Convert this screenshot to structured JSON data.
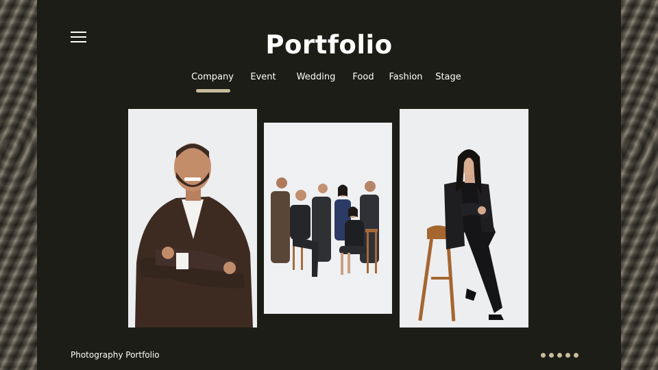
{
  "page": {
    "title": "Portfolio",
    "footer_label": "Photography Portfolio"
  },
  "nav": {
    "menu_icon": "hamburger-menu-icon",
    "tabs": [
      {
        "label": "Company",
        "active": true
      },
      {
        "label": "Event",
        "active": false
      },
      {
        "label": "Wedding",
        "active": false
      },
      {
        "label": "Food",
        "active": false
      },
      {
        "label": "Fashion",
        "active": false
      },
      {
        "label": "Stage",
        "active": false
      }
    ]
  },
  "gallery": {
    "photos": [
      {
        "subject": "smiling man in brown suit with arms crossed"
      },
      {
        "subject": "group of six business people in dark suits"
      },
      {
        "subject": "woman in black outfit seated on wooden stool"
      }
    ]
  },
  "pagination": {
    "dot_count": 5
  },
  "colors": {
    "background": "#1c1d16",
    "accent": "#c7bc9b",
    "text": "#ffffff"
  }
}
